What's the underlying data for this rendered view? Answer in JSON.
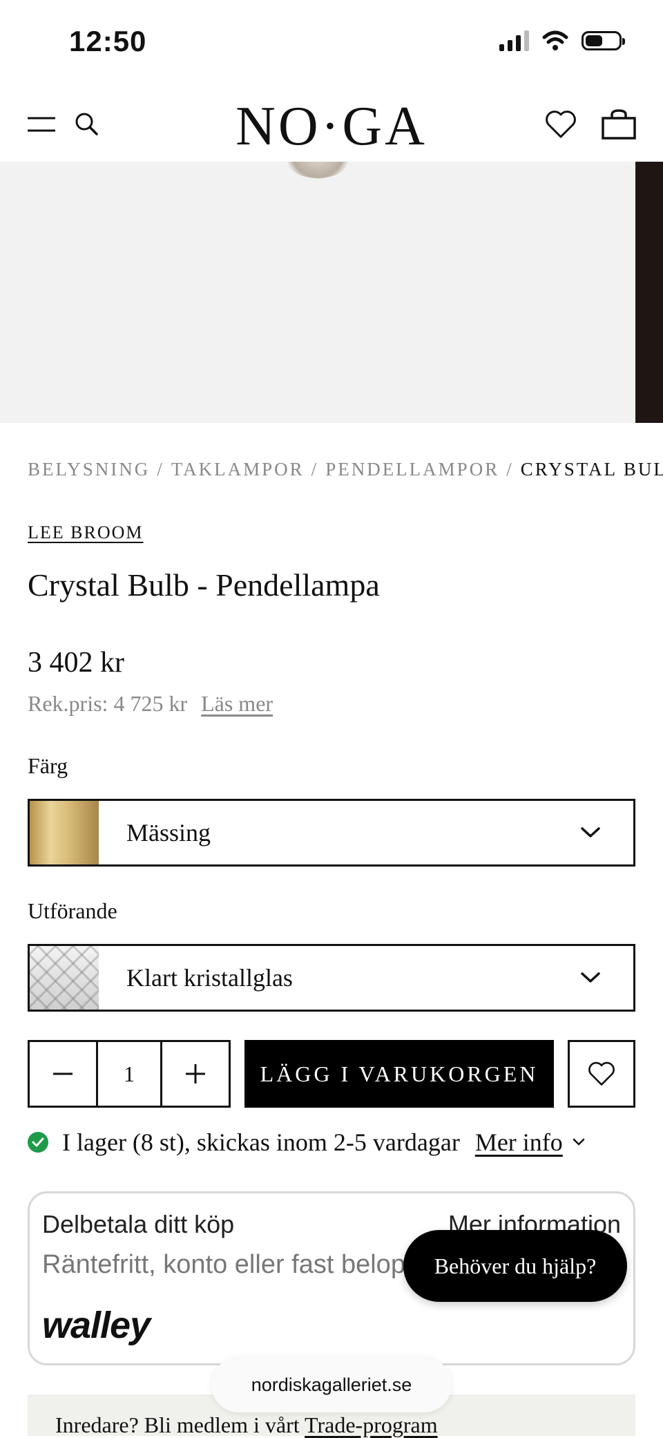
{
  "status_bar": {
    "time": "12:50"
  },
  "header": {
    "logo": "NO·GA"
  },
  "breadcrumb": {
    "items": [
      "BELYSNING",
      "TAKLAMPOR",
      "PENDELLAMPOR"
    ],
    "current": "CRYSTAL BULB",
    "separator": "/"
  },
  "product": {
    "brand": "LEE BROOM",
    "title": "Crystal Bulb - Pendellampa",
    "price": "3 402 kr",
    "rek_price": "Rek.pris: 4 725 kr",
    "rek_link": "Läs mer"
  },
  "options": {
    "color_label": "Färg",
    "color_value": "Mässing",
    "finish_label": "Utförande",
    "finish_value": "Klart kristallglas"
  },
  "cart": {
    "quantity": "1",
    "add_label": "LÄGG I VARUKORGEN"
  },
  "stock": {
    "text": "I lager (8 st), skickas inom 2-5 vardagar",
    "link": "Mer info",
    "status_color": "#1e9a4a"
  },
  "payment": {
    "title": "Delbetala ditt köp",
    "more": "Mer information",
    "subtitle": "Räntefritt, konto eller fast belopp",
    "provider": "walley"
  },
  "help": {
    "label": "Behöver du hjälp?"
  },
  "trade": {
    "text": "Inredare? Bli medlem i vårt ",
    "link": "Trade-program"
  },
  "browser": {
    "url": "nordiskagalleriet.se"
  }
}
